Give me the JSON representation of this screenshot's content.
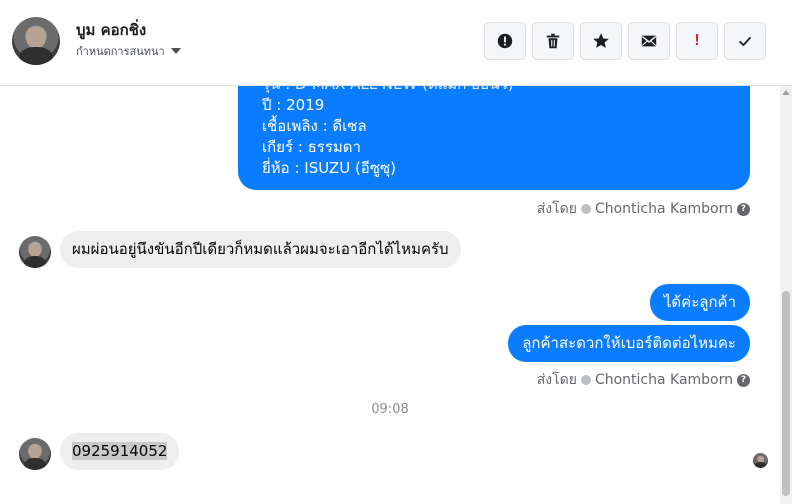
{
  "header": {
    "contact_name": "บูม คอกชิ่ง",
    "subtitle": "กำหนดการสนทนา",
    "buttons": [
      {
        "name": "report",
        "icon": "alert-circle-icon"
      },
      {
        "name": "delete",
        "icon": "trash-icon"
      },
      {
        "name": "star",
        "icon": "star-icon"
      },
      {
        "name": "mark-unread",
        "icon": "envelope-icon"
      },
      {
        "name": "important",
        "icon": "exclamation-icon",
        "label": "!"
      },
      {
        "name": "done",
        "icon": "check-icon"
      }
    ]
  },
  "messages": {
    "car_info_lines": [
      "รุ่น : D-MAX ALL NEW (ดีแม็ก ออนิว)",
      "ปี : 2019",
      "เชื้อเพลิง : ดีเซล",
      "เกียร์ : ธรรมดา",
      "ยี่ห้อ : ISUZU (อีซูซุ)"
    ],
    "sent_by_1": "ส่งโดย",
    "sent_by_1_name": "Chonticha Kamborn",
    "incoming_1": "ผมผ่อนอยู่นึงขันอีกปีเดียวก็หมดแล้วผมจะเอาอีกได้ไหมครับ",
    "outgoing_1": "ได้ค่ะลูกค้า",
    "outgoing_2": "ลูกค้าสะดวกให้เบอร์ติดต่อไหมคะ",
    "sent_by_2": "ส่งโดย",
    "sent_by_2_name": "Chonticha Kamborn",
    "time_separator": "09:08",
    "incoming_2": "0925914052"
  },
  "colors": {
    "outgoing_bubble": "#0a7cff",
    "incoming_bubble": "#eeeeee",
    "important_red": "#e4222e"
  }
}
